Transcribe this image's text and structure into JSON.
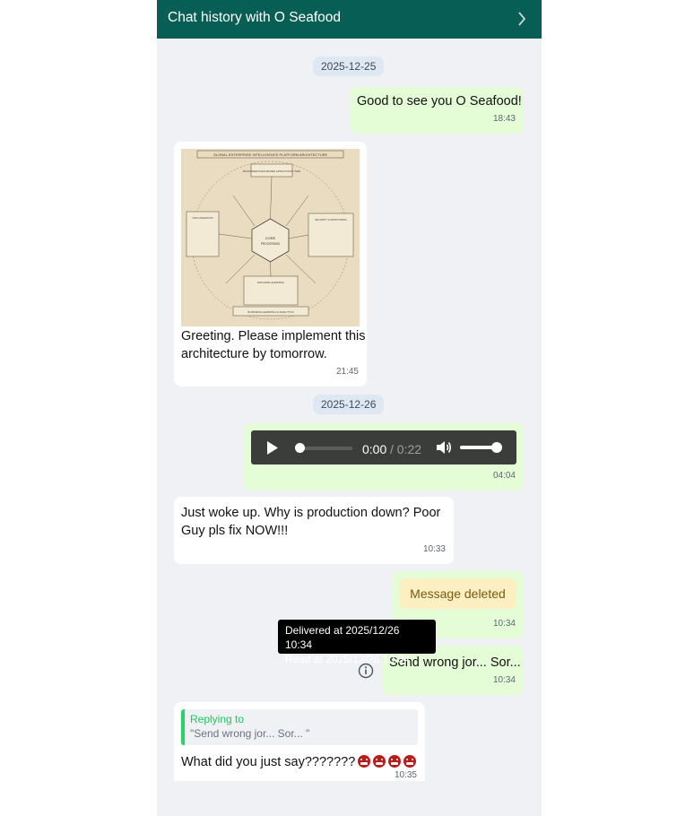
{
  "header": {
    "title": "Chat history with O Seafood",
    "chevron_icon": "chevron-right-icon"
  },
  "dates": [
    "2025-12-25",
    "2025-12-26"
  ],
  "messages": {
    "m1": {
      "text": "Good to see you O Seafood!",
      "time": "18:43"
    },
    "m2": {
      "image_alt": "Global enterprise intelligence platform architecture diagram",
      "image_title": "GLOBAL ENTERPRISE INTELLIGENCE PLATFORM ARCHITECTURE",
      "image_center": "CORE PROCESSING CLUSTER",
      "image_top": "MICROSERVICES-BASED APPLICATION TIER",
      "image_left": "DATA INGESTION & STREAMING PLATFORM",
      "image_right": "SECURITY & MONITORING LAYER",
      "image_bottom": "MACHINE LEARNING ENGINE",
      "image_footer": "BUSINESS LEARNING & ANALYTICS",
      "line1": "Greeting. Please implement this",
      "line2": "architecture by tomorrow.",
      "time": "21:45"
    },
    "m3": {
      "audio_current": "0:00",
      "audio_total": "/ 0:22",
      "time": "04:04"
    },
    "m4": {
      "line1": "Just woke up. Why is production down? Poor",
      "line2": "Guy pls fix NOW!!!",
      "time": "10:33"
    },
    "m5": {
      "deleted_label": "Message deleted",
      "time": "10:34"
    },
    "m6": {
      "text": "Send wrong jor... Sor...",
      "time": "10:34"
    },
    "m7": {
      "reply_label": "Replying to",
      "reply_quote": "\"Send wrong jor... Sor... \"",
      "text": "What did you just say???????",
      "time": "10:35"
    }
  },
  "tooltip": {
    "delivered": "Delivered at 2025/12/26 10:34",
    "read": "Read at 2025/12/26 10:34"
  },
  "colors": {
    "header": "#075e54",
    "outgoing": "#e4fdd7",
    "incoming": "#ffffff",
    "background": "#eff1f5",
    "reply_accent": "#25d366"
  }
}
